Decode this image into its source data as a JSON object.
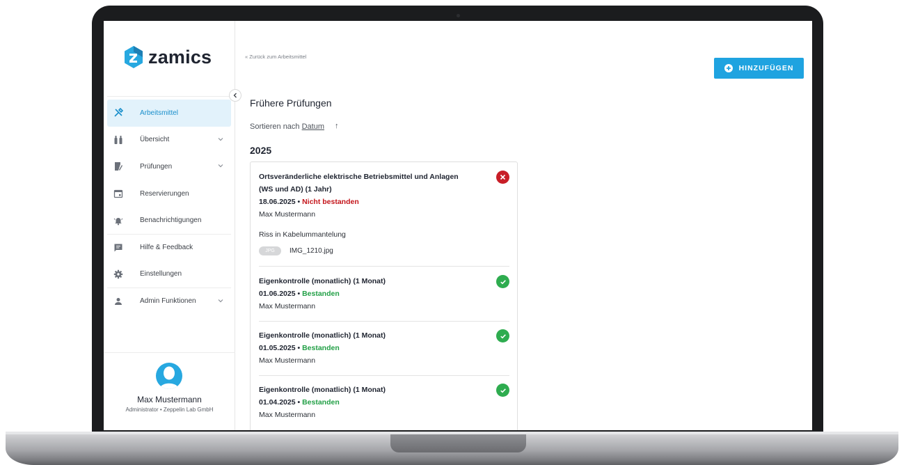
{
  "app": {
    "logo_text": "zamics",
    "back_link": "« Zurück zum Arbeitsmittel",
    "add_button": "HINZUFÜGEN"
  },
  "sidebar": {
    "items": [
      {
        "label": "Arbeitsmittel",
        "icon": "tools-icon",
        "active": true
      },
      {
        "label": "Übersicht",
        "icon": "binoculars-icon",
        "expandable": true
      },
      {
        "label": "Prüfungen",
        "icon": "clipboard-icon",
        "expandable": true
      },
      {
        "label": "Reservierungen",
        "icon": "calendar-icon"
      },
      {
        "label": "Benachrichtigungen",
        "icon": "bell-icon"
      },
      {
        "label": "Hilfe & Feedback",
        "icon": "feedback-icon"
      },
      {
        "label": "Einstellungen",
        "icon": "gear-icon"
      },
      {
        "label": "Admin Funktionen",
        "icon": "person-icon",
        "expandable": true
      }
    ],
    "user": {
      "name": "Max Mustermann",
      "role": "Administrator • Zeppelin Lab GmbH"
    }
  },
  "main": {
    "title": "Frühere Prüfungen",
    "sort_prefix": "Sortieren nach ",
    "sort_field": "Datum",
    "sort_arrow": "↑",
    "year": "2025",
    "entries": [
      {
        "title_line1": "Ortsveränderliche elektrische Betriebsmittel und Anlagen",
        "title_line2": "(WS und AD) (1 Jahr)",
        "date": "18.06.2025",
        "status": "Nicht bestanden",
        "status_kind": "fail",
        "person": "Max Mustermann",
        "note": "Riss in Kabelummantelung",
        "attachment_type": "JPG",
        "attachment_name": "IMG_1210.jpg"
      },
      {
        "title_line1": "Eigenkontrolle (monatlich) (1 Monat)",
        "date": "01.06.2025",
        "status": "Bestanden",
        "status_kind": "pass",
        "person": "Max Mustermann"
      },
      {
        "title_line1": "Eigenkontrolle (monatlich) (1 Monat)",
        "date": "01.05.2025",
        "status": "Bestanden",
        "status_kind": "pass",
        "person": "Max Mustermann"
      },
      {
        "title_line1": "Eigenkontrolle (monatlich) (1 Monat)",
        "date": "01.04.2025",
        "status": "Bestanden",
        "status_kind": "pass",
        "person": "Max Mustermann"
      }
    ],
    "separator": " • "
  },
  "colors": {
    "accent": "#1fa3e0",
    "fail": "#c4161c",
    "pass": "#23a047",
    "active_bg": "#e2f2fb"
  }
}
